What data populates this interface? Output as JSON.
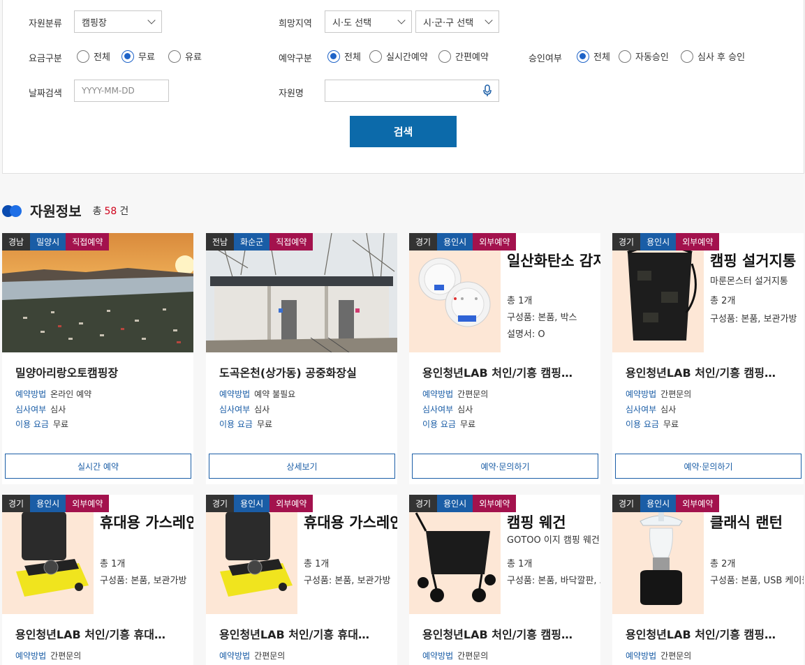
{
  "filters": {
    "resource_type": {
      "label": "자원분류",
      "value": "캠핑장"
    },
    "region": {
      "label": "희망지역",
      "sido": "시·도 선택",
      "sigungu": "시·군·구 선택"
    },
    "fee": {
      "label": "요금구분",
      "options": [
        "전체",
        "무료",
        "유료"
      ],
      "selected": 1
    },
    "reserve_type": {
      "label": "예약구분",
      "options": [
        "전체",
        "실시간예약",
        "간편예약"
      ],
      "selected": 0
    },
    "approval": {
      "label": "승인여부",
      "options": [
        "전체",
        "자동승인",
        "심사 후 승인"
      ],
      "selected": 0
    },
    "date": {
      "label": "날짜검색",
      "placeholder": "YYYY-MM-DD"
    },
    "name": {
      "label": "자원명",
      "value": ""
    },
    "search_button": "검색"
  },
  "section": {
    "title": "자원정보",
    "count_prefix": "총",
    "count": "58",
    "count_suffix": "건"
  },
  "meta_labels": {
    "method": "예약방법",
    "review": "심사여부",
    "fee": "이용 요금"
  },
  "cards": [
    {
      "tags": [
        "경남",
        "밀양시",
        "직접예약"
      ],
      "title": "밀양아리랑오토캠핑장",
      "method": "온라인 예약",
      "review": "심사",
      "fee": "무료",
      "button": "실시간 예약"
    },
    {
      "tags": [
        "전남",
        "화순군",
        "직접예약"
      ],
      "title": "도곡온천(상가동) 공중화장실",
      "method": "예약 불필요",
      "review": "심사",
      "fee": "무료",
      "button": "상세보기"
    },
    {
      "tags": [
        "경기",
        "용인시",
        "외부예약"
      ],
      "title": "용인청년LAB 처인/기흥 캠핑…",
      "method": "간편문의",
      "review": "심사",
      "fee": "무료",
      "button": "예약·문의하기",
      "poster": {
        "title": "일산화탄소 감지기",
        "lines": [
          "총 1개",
          "구성품: 본품, 박스",
          "설명서: O"
        ]
      }
    },
    {
      "tags": [
        "경기",
        "용인시",
        "외부예약"
      ],
      "title": "용인청년LAB 처인/기흥 캠핑…",
      "method": "간편문의",
      "review": "심사",
      "fee": "무료",
      "button": "예약·문의하기",
      "poster": {
        "title": "캠핑 설거지통",
        "lines": [
          "마룬몬스터 설거지통",
          "총 2개",
          "구성품: 본품, 보관가방"
        ]
      }
    },
    {
      "tags": [
        "경기",
        "용인시",
        "외부예약"
      ],
      "title": "용인청년LAB 처인/기흥 휴대…",
      "method": "간편문의",
      "poster": {
        "title": "휴대용 가스레인지",
        "lines": [
          "총 1개",
          "구성품: 본품, 보관가방"
        ]
      }
    },
    {
      "tags": [
        "경기",
        "용인시",
        "외부예약"
      ],
      "title": "용인청년LAB 처인/기흥 휴대…",
      "method": "간편문의",
      "poster": {
        "title": "휴대용 가스레인지",
        "lines": [
          "총 1개",
          "구성품: 본품, 보관가방"
        ]
      }
    },
    {
      "tags": [
        "경기",
        "용인시",
        "외부예약"
      ],
      "title": "용인청년LAB 처인/기흥 캠핑…",
      "method": "간편문의",
      "poster": {
        "title": "캠핑 웨건",
        "lines": [
          "GOTOO 이지 캠핑 웨건",
          "총 1개",
          "구성품: 본품, 바닥깔판, 보관가방"
        ]
      }
    },
    {
      "tags": [
        "경기",
        "용인시",
        "외부예약"
      ],
      "title": "용인청년LAB 처인/기흥 캠핑…",
      "method": "간편문의",
      "poster": {
        "title": "클래식 랜턴",
        "lines": [
          "총 2개",
          "구성품: 본품, USB 케이블"
        ]
      }
    }
  ]
}
